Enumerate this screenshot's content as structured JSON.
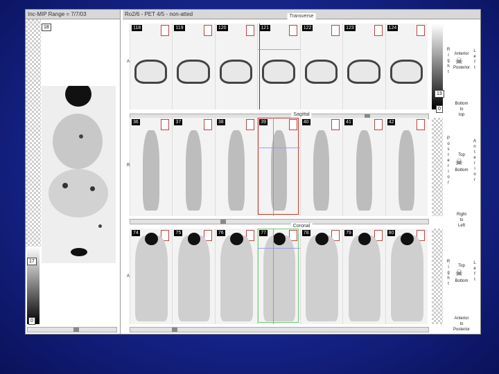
{
  "mip": {
    "title": "Inc-MIP Range = 7/7/03",
    "frame_number": "18",
    "scale_top": "17",
    "scale_bottom": "0"
  },
  "viewer": {
    "title": "Ro2/6 - PET 4/5 - non-atted",
    "transverse": {
      "label": "Transverse",
      "axis_letter": "A",
      "scale_top": "13",
      "scale_bottom": "0",
      "frames": [
        "118",
        "119",
        "120",
        "121",
        "122",
        "123",
        "124"
      ]
    },
    "sagittal": {
      "label": "Sagittal",
      "axis_letter": "R",
      "frames": [
        "36",
        "37",
        "38",
        "39",
        "40",
        "41",
        "42"
      ]
    },
    "coronal": {
      "label": "Coronal",
      "axis_letter": "A",
      "frames": [
        "74",
        "75",
        "76",
        "77",
        "78",
        "79",
        "80"
      ]
    }
  },
  "orientation": {
    "transverse": {
      "left_letters": [
        "R",
        "i",
        "g",
        "h",
        "t"
      ],
      "right_letters": [
        "L",
        "e",
        "f",
        "t"
      ],
      "top": "Anterior",
      "bottom": "Posterior",
      "below": "Bottom",
      "below2": "to",
      "below3": "top"
    },
    "sagittal": {
      "left_letters": [
        "P",
        "o",
        "s",
        "t",
        "e",
        "r",
        "i",
        "o",
        "r"
      ],
      "right_letters": [
        "A",
        "n",
        "t",
        "e",
        "r",
        "i",
        "o",
        "r"
      ],
      "top": "Top",
      "bottom": "Bottom",
      "below": "Right",
      "below2": "to",
      "below3": "Left"
    },
    "coronal": {
      "left_letters": [
        "R",
        "i",
        "g",
        "h",
        "t"
      ],
      "right_letters": [
        "L",
        "e",
        "f",
        "t"
      ],
      "top": "Top",
      "bottom": "Bottom",
      "below": "Anterior",
      "below2": "to",
      "below3": "Posterior"
    }
  }
}
